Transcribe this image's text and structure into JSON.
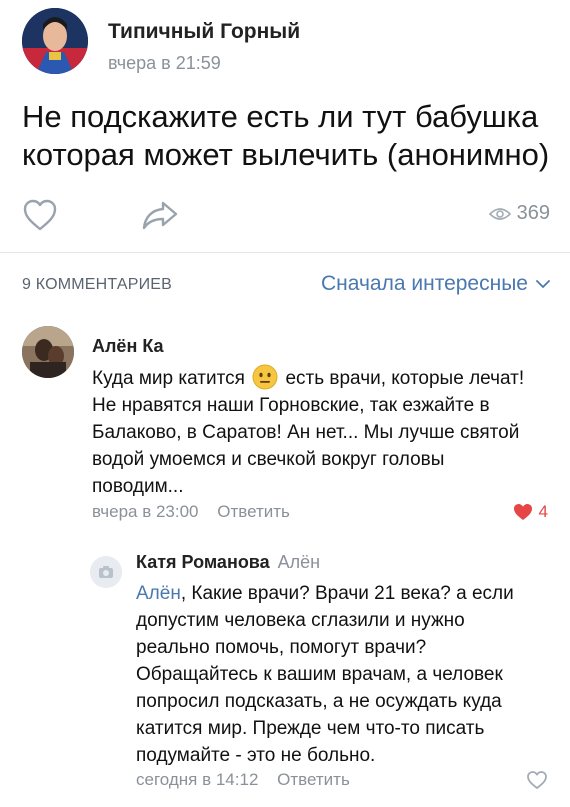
{
  "post": {
    "author": "Типичный Горный",
    "time": "вчера в 21:59",
    "text": "Не подскажите есть ли тут бабушка которая может вылечить (анонимно)",
    "views": "369"
  },
  "comments_bar": {
    "count_label": "9 КОММЕНТАРИЕВ",
    "sort_label": "Сначала интересные"
  },
  "comments": [
    {
      "author": "Алён Ка",
      "text_before_emoji": "Куда мир катится",
      "text_after_emoji": "есть врачи, которые лечат! Не нравятся наши Горновские, так езжайте в Балаково, в Саратов! Ан нет... Мы лучше святой водой умоемся и свечкой вокруг головы поводим...",
      "time": "вчера в 23:00",
      "reply_label": "Ответить",
      "likes": "4"
    },
    {
      "author": "Катя Романова",
      "reply_to": "Алён",
      "mention": "Алён",
      "text": ", Какие врачи? Врачи 21 века? а если допустим человека сглазили и нужно реально помочь, помогут врачи? Обращайтесь к вашим врачам, а человек попросил подсказать, а не осуждать куда катится мир. Прежде чем что-то писать подумайте - это не больно.",
      "time": "сегодня в 14:12",
      "reply_label": "Ответить"
    }
  ],
  "colors": {
    "accent": "#4a78b0",
    "muted": "#8a9199",
    "like_active": "#e64646"
  }
}
